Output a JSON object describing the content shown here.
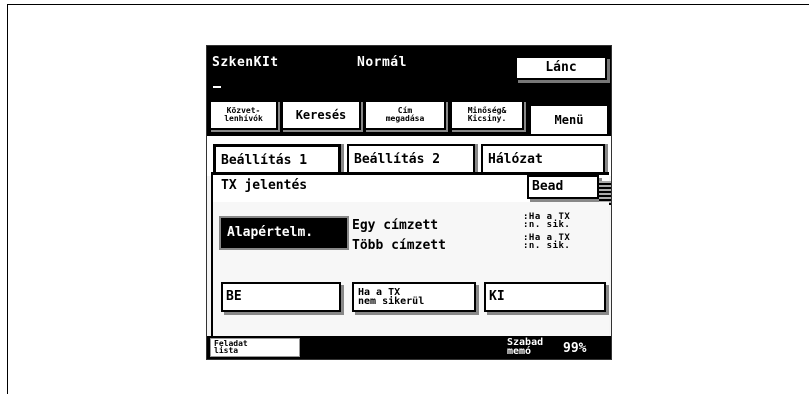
{
  "status": {
    "mode": "SzkenKIt",
    "quality": "Normál",
    "chain_button": "Lánc"
  },
  "tabs": [
    {
      "label": "Közvet-\nlenhívók"
    },
    {
      "label": "Keresés"
    },
    {
      "label": "Cím\nmegadása"
    },
    {
      "label": "Minőség&\nKicsiny."
    },
    {
      "label": "Menü"
    }
  ],
  "subtabs": [
    {
      "label": "Beállítás 1"
    },
    {
      "label": "Beállítás 2"
    },
    {
      "label": "Hálózat"
    }
  ],
  "panel": {
    "title": "TX jelentés",
    "send_button": "Bead",
    "default_button": "Alapértelm.",
    "recipient_single": "Egy címzett",
    "recipient_multi": "Több címzett",
    "note_1": ":Ha a TX\n:n. sik.",
    "note_2": ":Ha a TX\n:n. sik.",
    "options": {
      "on": "BE",
      "on_fail": "Ha a TX\nnem sikerül",
      "off": "KI"
    }
  },
  "footer": {
    "jobs_button": "Feladat\nlista",
    "free_memory_label": "Szabad\nmemó",
    "free_memory_value": "99%"
  }
}
